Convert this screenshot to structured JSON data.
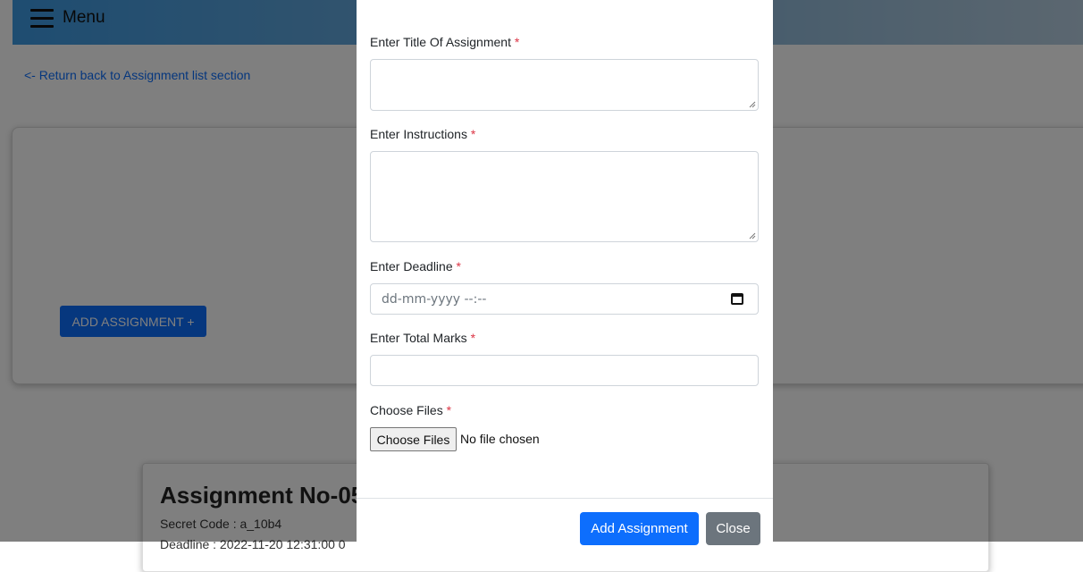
{
  "topbar": {
    "menu_label": "Menu"
  },
  "back_link": "<- Return back to Assignment list section",
  "add_assignment_button": "ADD ASSIGNMENT +",
  "assignment_card": {
    "title": "Assignment No-05",
    "secret_code": "Secret Code : a_10b4",
    "deadline": "Deadline : 2022-11-20 12:31:00 0"
  },
  "modal": {
    "title_label": "Enter Title Of Assignment",
    "instructions_label": "Enter Instructions",
    "deadline_label": "Enter Deadline",
    "deadline_placeholder": "dd-mm-yyyy --:--",
    "marks_label": "Enter Total Marks",
    "files_label": "Choose Files",
    "required_marker": "*",
    "choose_files_button": "Choose Files",
    "file_status": "No file chosen",
    "submit_button": "Add Assignment",
    "close_button": "Close"
  },
  "colors": {
    "primary": "#0d6efd",
    "secondary": "#6c757d",
    "required": "#dc3545",
    "topbar_start": "#3d9ae3"
  },
  "icons": [
    "hamburger-menu-icon",
    "calendar-icon",
    "resize-grip-icon"
  ]
}
